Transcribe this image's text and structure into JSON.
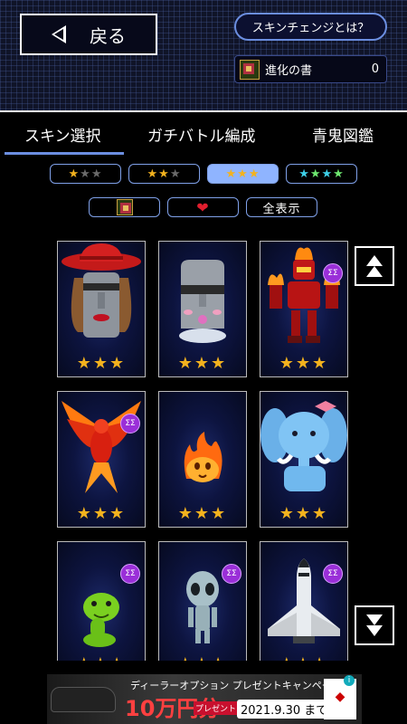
{
  "header": {
    "back_label": "戻る",
    "skin_change_label": "スキンチェンジとは？",
    "item": {
      "name": "進化の書",
      "count": "0"
    }
  },
  "tabs": [
    {
      "label": "スキン選択",
      "active": true
    },
    {
      "label": "ガチバトル編成",
      "active": false
    },
    {
      "label": "青鬼図鑑",
      "active": false
    }
  ],
  "rarity_filters": [
    {
      "stars": 1,
      "max": 3,
      "active": false
    },
    {
      "stars": 2,
      "max": 3,
      "active": false
    },
    {
      "stars": 3,
      "max": 3,
      "active": true
    },
    {
      "stars": 4,
      "max": 4,
      "active": false,
      "colors": [
        "#3ed0e8",
        "#6ee870",
        "#3ed0e8",
        "#6ee870"
      ]
    }
  ],
  "type_filters": {
    "book_icon": "evolution-book-icon",
    "heart_icon": "heart-icon",
    "show_all_label": "全表示"
  },
  "skins": [
    {
      "name": "moai-red-hat",
      "stars": 3,
      "evolved": false
    },
    {
      "name": "moai-smile",
      "stars": 3,
      "evolved": false
    },
    {
      "name": "flame-robot",
      "stars": 3,
      "evolved": true
    },
    {
      "name": "phoenix",
      "stars": 3,
      "evolved": true
    },
    {
      "name": "fire-spirit",
      "stars": 3,
      "evolved": false
    },
    {
      "name": "elephant",
      "stars": 3,
      "evolved": false
    },
    {
      "name": "snake",
      "stars": 3,
      "evolved": true
    },
    {
      "name": "alien",
      "stars": 3,
      "evolved": true
    },
    {
      "name": "space-shuttle",
      "stars": 3,
      "evolved": true
    }
  ],
  "evolved_badge_text": "ΣΣ",
  "scroll": {
    "up_icon": "scroll-up-icon",
    "down_icon": "scroll-down-icon"
  },
  "ad": {
    "headline": "ディーラーオプション プレゼントキャンペーン",
    "amount": "10万円分",
    "amount_note": "プレゼント",
    "date": "2021.9.30 まで",
    "brand": "MITSUBISHI MOTORS",
    "info_icon": "i"
  }
}
